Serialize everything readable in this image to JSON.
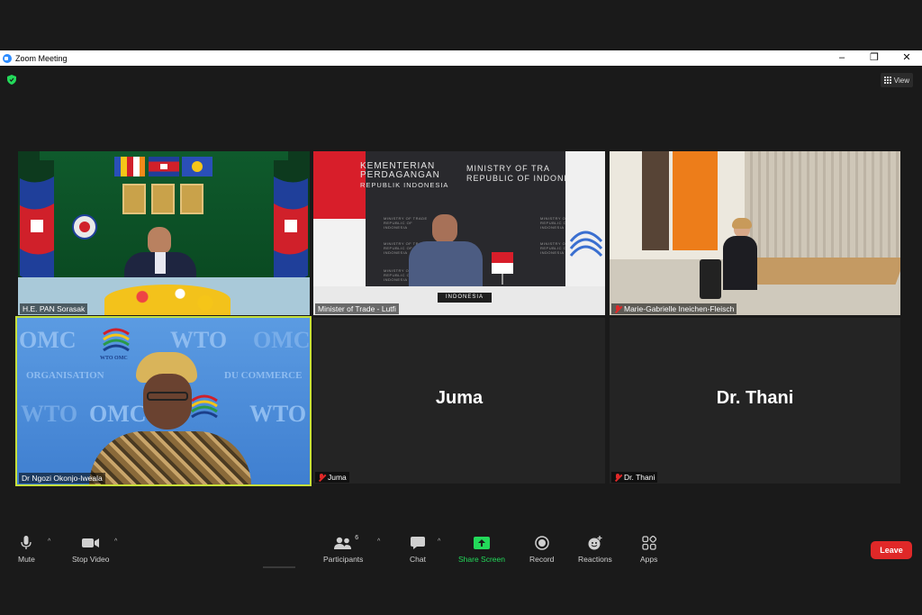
{
  "window": {
    "title": "Zoom Meeting",
    "controls": {
      "minimize": "–",
      "restore": "❐",
      "close": "✕"
    }
  },
  "meeting": {
    "view_label": "View",
    "participants": [
      {
        "name": "H.E. PAN Sorasak",
        "muted": false
      },
      {
        "name": "Minister of Trade - Lutfi",
        "muted": false
      },
      {
        "name": "Marie-Gabrielle Ineichen-Fleisch",
        "muted": true
      },
      {
        "name": "Dr Ngozi Okonjo-Iweala",
        "muted": false,
        "active_speaker": true
      },
      {
        "name": "Juma",
        "display": "Juma",
        "muted": true,
        "video_off": true
      },
      {
        "name": "Dr. Thani",
        "display": "Dr. Thani",
        "muted": true,
        "video_off": true
      }
    ],
    "backdrops": {
      "indonesia": {
        "line1": "KEMENTERIAN",
        "line2": "PERDAGANGAN",
        "line3": "REPUBLIK INDONESIA",
        "line4": "MINISTRY OF TRA",
        "line5": "REPUBLIC OF INDONE",
        "placard": "INDONESIA",
        "small": "MINISTRY OF TRADE REPUBLIC OF INDONESIA"
      },
      "wto": {
        "omc": "OMC",
        "wto": "WTO",
        "small": "WTO OMC",
        "organisation": "ORGANISATION",
        "commerce": "DU COMMERCE"
      }
    }
  },
  "toolbar": {
    "mute": "Mute",
    "stop_video": "Stop Video",
    "participants": "Participants",
    "participants_count": "6",
    "chat": "Chat",
    "share_screen": "Share Screen",
    "record": "Record",
    "reactions": "Reactions",
    "apps": "Apps",
    "leave": "Leave"
  },
  "colors": {
    "share_green": "#23d95a",
    "leave_red": "#e02828",
    "active_speaker_border": "#c7e03a",
    "security_shield": "#23d95a"
  }
}
